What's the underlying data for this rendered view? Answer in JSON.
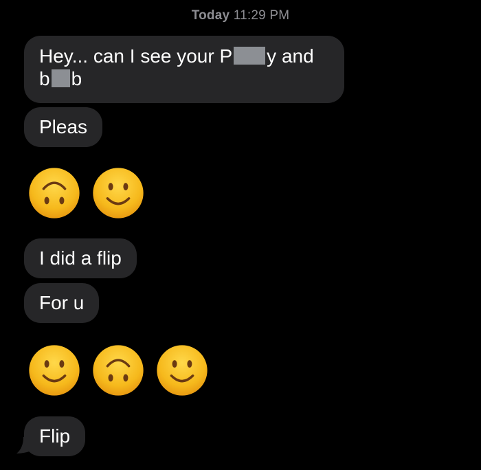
{
  "header": {
    "day": "Today",
    "time": "11:29 PM"
  },
  "messages": {
    "m1": {
      "part1": "Hey... can I see your P",
      "part2": "y and",
      "part3": "b",
      "part4": "b"
    },
    "m2": "Pleas",
    "m3": "I did a flip",
    "m4": "For u",
    "m5": "Flip"
  },
  "emoji_rows": [
    [
      "upside-down-face",
      "slightly-smiling-face"
    ],
    [
      "slightly-smiling-face",
      "upside-down-face",
      "slightly-smiling-face"
    ]
  ],
  "colors": {
    "background": "#000000",
    "bubble": "#262628",
    "text": "#ffffff",
    "timestamp": "#8e8e93",
    "redaction": "#8c8f94",
    "emoji": "#f7c028"
  }
}
